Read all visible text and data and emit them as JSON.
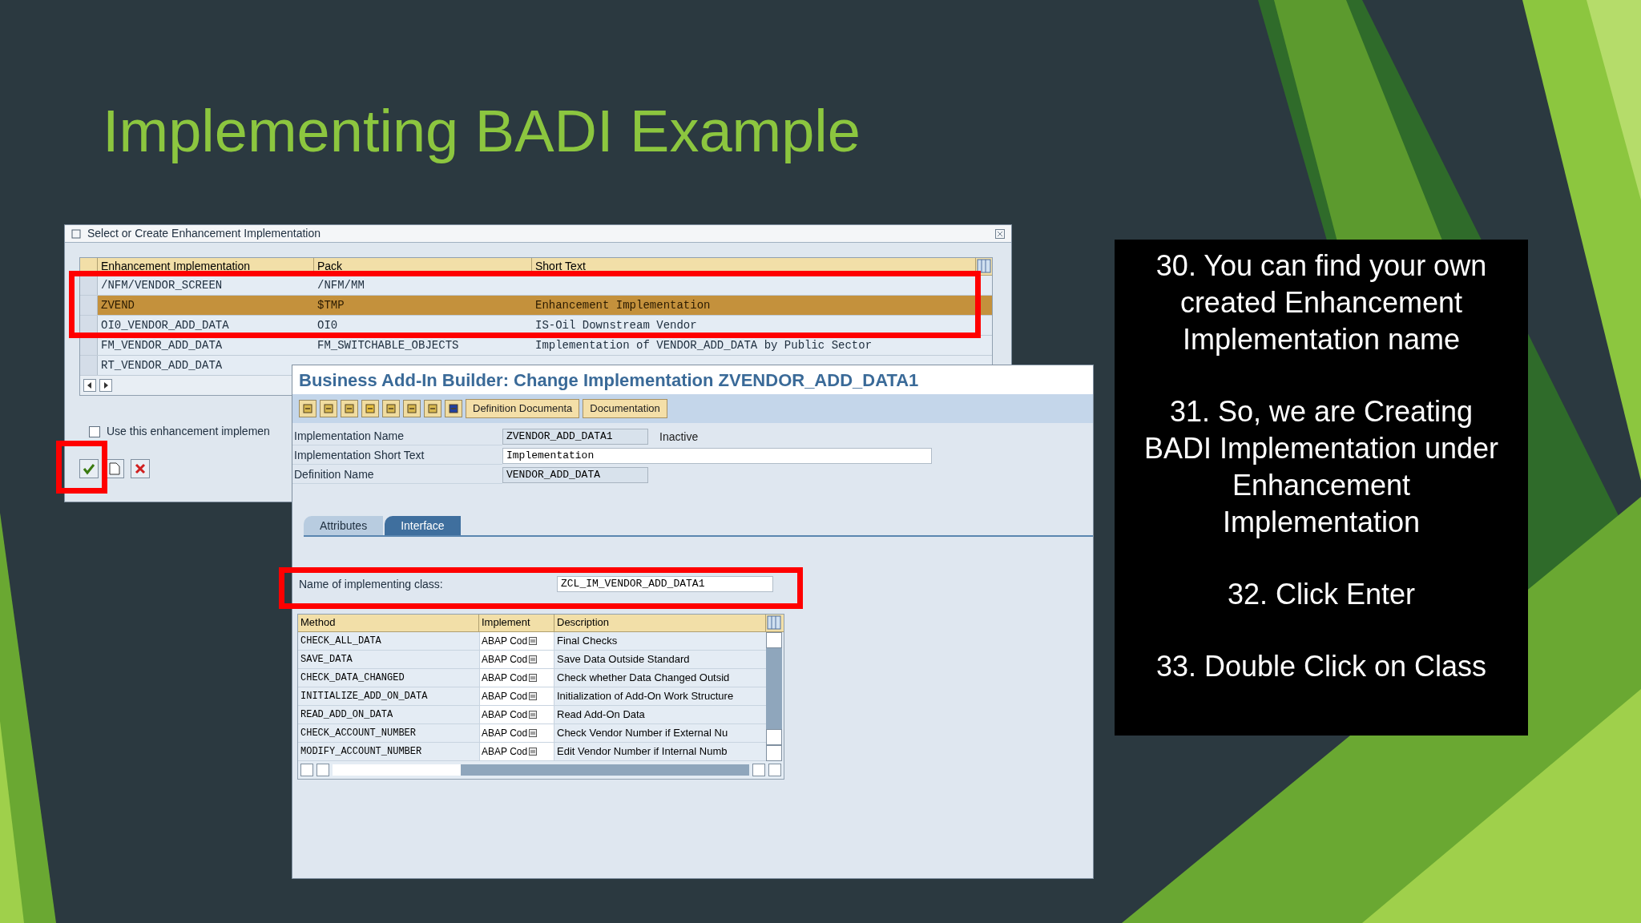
{
  "slide": {
    "title": "Implementing BADI Example"
  },
  "select_dialog": {
    "title": "Select or Create Enhancement Implementation",
    "columns": [
      "Enhancement Implementation",
      "Pack",
      "Short Text"
    ],
    "rows": [
      {
        "name": "/NFM/VENDOR_SCREEN",
        "pack": "/NFM/MM",
        "selected": false
      },
      {
        "name": "ZVEND",
        "pack": "$TMP",
        "short_text": "Enhancement Implementation",
        "selected": true
      },
      {
        "name": "OI0_VENDOR_ADD_DATA",
        "pack": "OI0",
        "short_text": "IS-Oil Downstream Vendor",
        "selected": false
      },
      {
        "name": "FM_VENDOR_ADD_DATA",
        "pack": "FM_SWITCHABLE_OBJECTS",
        "short_text": "Implementation of VENDOR_ADD_DATA by Public Sector",
        "selected": false
      },
      {
        "name": "RT_VENDOR_ADD_DATA",
        "selected": false
      }
    ],
    "use_checkbox": {
      "label": "Use this enhancement implemen",
      "checked": false
    },
    "buttons": [
      {
        "kind": "confirm"
      },
      {
        "kind": "new"
      },
      {
        "kind": "cancel"
      }
    ]
  },
  "builder": {
    "title": "Business Add-In Builder: Change Implementation ZVENDOR_ADD_DATA1",
    "toolbar_buttons": [
      "Definition Documenta",
      "Documentation"
    ],
    "fields": [
      {
        "label": "Implementation Name",
        "value": "ZVENDOR_ADD_DATA1",
        "status": "Inactive",
        "editable": false
      },
      {
        "label": "Implementation Short Text",
        "value": "Implementation",
        "editable": true
      },
      {
        "label": "Definition Name",
        "value": "VENDOR_ADD_DATA",
        "editable": false
      }
    ],
    "tabs": [
      {
        "label": "Attributes",
        "selected": false
      },
      {
        "label": "Interface",
        "selected": true
      }
    ],
    "class_field": {
      "label": "Name of implementing class:",
      "value": "ZCL_IM_VENDOR_ADD_DATA1"
    },
    "methods": {
      "columns": [
        "Method",
        "Implement",
        "Description"
      ],
      "rows": [
        {
          "method": "CHECK_ALL_DATA",
          "implement": "ABAP Cod",
          "description": "Final Checks"
        },
        {
          "method": "SAVE_DATA",
          "implement": "ABAP Cod",
          "description": "Save Data Outside Standard"
        },
        {
          "method": "CHECK_DATA_CHANGED",
          "implement": "ABAP Cod",
          "description": "Check whether Data Changed Outsid"
        },
        {
          "method": "INITIALIZE_ADD_ON_DATA",
          "implement": "ABAP Cod",
          "description": "Initialization of Add-On Work Structure"
        },
        {
          "method": "READ_ADD_ON_DATA",
          "implement": "ABAP Cod",
          "description": "Read Add-On Data"
        },
        {
          "method": "CHECK_ACCOUNT_NUMBER",
          "implement": "ABAP Cod",
          "description": "Check Vendor Number if External Nu"
        },
        {
          "method": "MODIFY_ACCOUNT_NUMBER",
          "implement": "ABAP Cod",
          "description": "Edit Vendor Number if Internal Numb"
        }
      ]
    }
  },
  "notes": [
    "30. You can find your own created Enhancement Implementation name",
    "31. So, we are Creating BADI Implementation under Enhancement Implementation",
    "32. Click Enter",
    "33. Double Click on Class"
  ]
}
